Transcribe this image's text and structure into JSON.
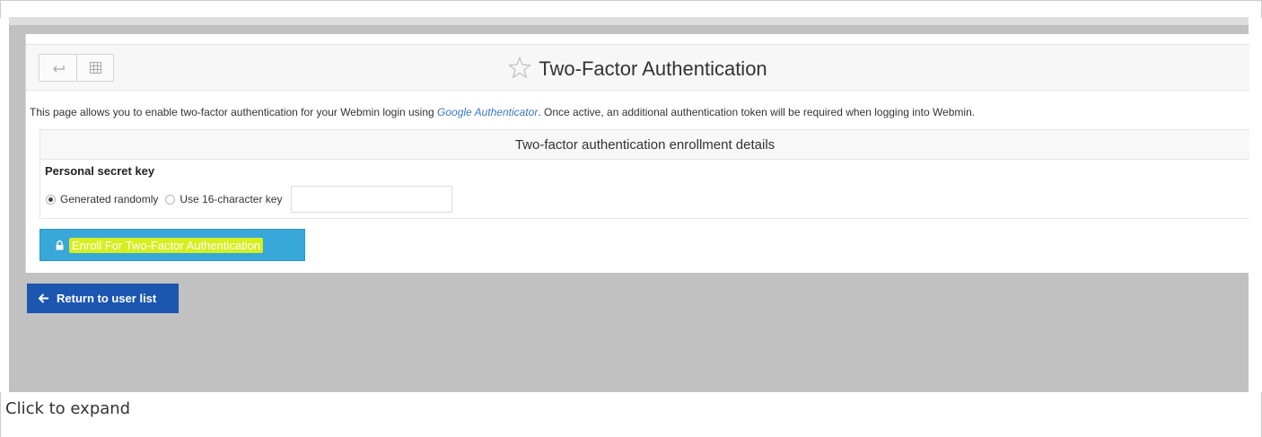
{
  "header": {
    "title": "Two-Factor Authentication",
    "back_icon": "back-arrow-icon",
    "grid_icon": "grid-icon",
    "star_icon": "star-outline-icon"
  },
  "description": {
    "before_link": "This page allows you to enable two-factor authentication for your Webmin login using ",
    "link_text": "Google Authenticator",
    "after_link": ". Once active, an additional authentication token will be required when logging into Webmin."
  },
  "enrollment": {
    "heading": "Two-factor authentication enrollment details",
    "field_label": "Personal secret key",
    "options": [
      "Generated randomly",
      "Use 16-character key"
    ],
    "selected_option": "Generated randomly",
    "key_value": ""
  },
  "buttons": {
    "enroll_label": "Enroll For Two-Factor Authentication",
    "return_label": "Return to user list"
  },
  "caption": "Click to expand",
  "colors": {
    "enroll_button": "#38a7d9",
    "highlight": "#d5ef1f",
    "return_button": "#1b56b1",
    "background": "#c1c1c1",
    "link": "#3a78c3"
  }
}
